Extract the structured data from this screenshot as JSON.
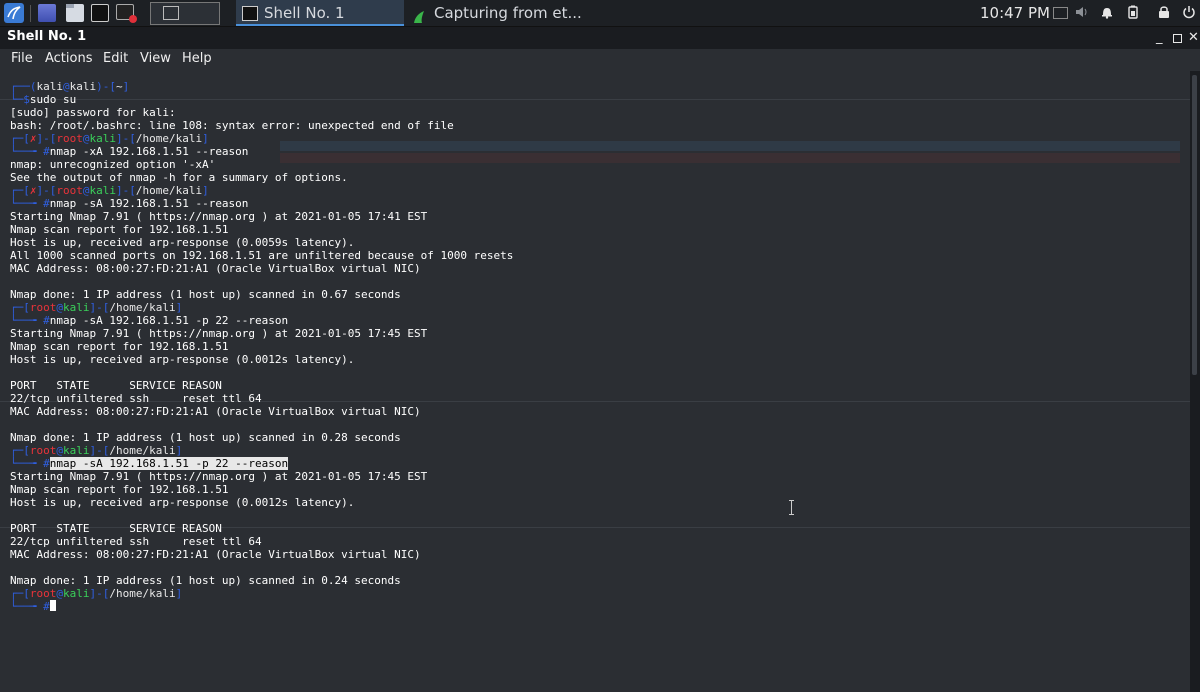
{
  "taskbar": {
    "tasks": [
      {
        "label": "Shell No. 1",
        "icon": "terminal-icon",
        "active": true
      },
      {
        "label": "Capturing from et...",
        "icon": "wireshark-fin-icon",
        "active": false
      }
    ],
    "clock": "10:47 PM",
    "launchers": [
      "kali-menu-icon",
      "desktop-icon",
      "file-manager-icon",
      "terminal-icon",
      "screen-recorder-icon"
    ],
    "tray_icons": [
      "monitor-icon",
      "volume-icon",
      "bell-icon",
      "battery-icon",
      "lock-icon",
      "power-icon"
    ]
  },
  "window": {
    "title": "Shell No. 1",
    "controls": {
      "minimize": "_",
      "close": "✕"
    }
  },
  "menu": [
    "File",
    "Actions",
    "Edit",
    "View",
    "Help"
  ],
  "prompts": {
    "user": "kali",
    "host": "kali",
    "root": "root",
    "at": "@",
    "home_user": "~",
    "home_root": "/home/kali",
    "error_mark": "✗",
    "user_symbol": "$",
    "root_symbol": "#"
  },
  "terminal": {
    "cmd_sudo": "sudo su",
    "out_password": "[sudo] password for kali:",
    "out_bash_error": "bash: /root/.bashrc: line 108: syntax error: unexpected end of file",
    "cmd_nmap_xa": "nmap -xA 192.168.1.51 --reason",
    "out_unrecognized": "nmap: unrecognized option '-xA'",
    "out_see_output": "See the output of nmap -h for a summary of options.",
    "cmd_nmap_sa": "nmap -sA 192.168.1.51 --reason",
    "out_start_1741": "Starting Nmap 7.91 ( https://nmap.org ) at 2021-01-05 17:41 EST",
    "out_report": "Nmap scan report for 192.168.1.51",
    "out_host_up_0059": "Host is up, received arp-response (0.0059s latency).",
    "out_all_unfiltered": "All 1000 scanned ports on 192.168.1.51 are unfiltered because of 1000 resets",
    "out_mac": "MAC Address: 08:00:27:FD:21:A1 (Oracle VirtualBox virtual NIC)",
    "out_done_067": "Nmap done: 1 IP address (1 host up) scanned in 0.67 seconds",
    "cmd_nmap_p22": "nmap -sA 192.168.1.51 -p 22 --reason",
    "out_start_1745": "Starting Nmap 7.91 ( https://nmap.org ) at 2021-01-05 17:45 EST",
    "out_host_up_0012": "Host is up, received arp-response (0.0012s latency).",
    "out_table_header": "PORT   STATE      SERVICE REASON",
    "out_table_row": "22/tcp unfiltered ssh     reset ttl 64",
    "out_done_028": "Nmap done: 1 IP address (1 host up) scanned in 0.28 seconds",
    "out_done_024": "Nmap done: 1 IP address (1 host up) scanned in 0.24 seconds"
  },
  "colors": {
    "bracket": "#2f5fe0",
    "root": "#e8333a",
    "host": "#3ad05a",
    "background": "#2b2e33"
  }
}
